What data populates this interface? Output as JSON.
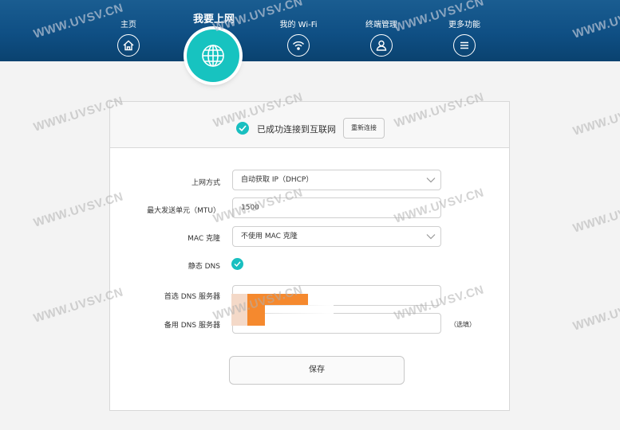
{
  "nav": {
    "items": [
      {
        "label": "主页",
        "icon": "home-icon"
      },
      {
        "label": "我的 Wi-Fi",
        "icon": "wifi-icon"
      },
      {
        "label": "终端管理",
        "icon": "user-icon"
      },
      {
        "label": "更多功能",
        "icon": "menu-icon"
      }
    ],
    "active": {
      "label": "我要上网",
      "icon": "globe-icon"
    }
  },
  "status": {
    "text": "已成功连接到互联网",
    "reconnect_label": "重新连接"
  },
  "form": {
    "connection_type": {
      "label": "上网方式",
      "value": "自动获取 IP（DHCP）"
    },
    "mtu": {
      "label": "最大发送单元（MTU）",
      "value": "1500"
    },
    "mac_clone": {
      "label": "MAC 克隆",
      "value": "不使用 MAC 克隆"
    },
    "static_dns": {
      "label": "静态 DNS",
      "checked": true
    },
    "primary_dns": {
      "label": "首选 DNS 服务器",
      "value": ""
    },
    "secondary_dns": {
      "label": "备用 DNS 服务器",
      "value": "",
      "hint": "（选填）"
    },
    "save_label": "保存"
  },
  "watermark": "WWW.UVSV.CN",
  "colors": {
    "header": "#0f4f84",
    "accent": "#17c3c0",
    "redaction": "#f5892e"
  }
}
